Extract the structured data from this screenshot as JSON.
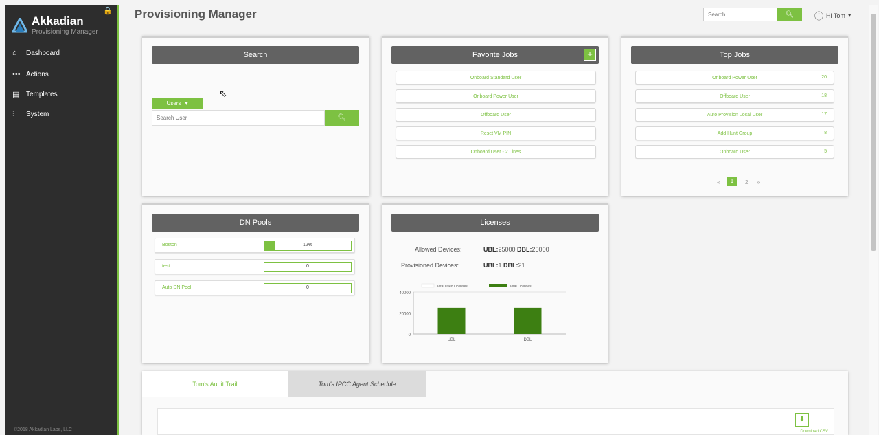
{
  "sidebar": {
    "brand_name": "Akkadian",
    "brand_sub": "Provisioning Manager",
    "items": [
      {
        "label": "Dashboard",
        "icon": "home-icon"
      },
      {
        "label": "Actions",
        "icon": "dots-icon"
      },
      {
        "label": "Templates",
        "icon": "template-icon"
      },
      {
        "label": "System",
        "icon": "sliders-icon"
      }
    ],
    "copyright": "©2018 Akkadian Labs, LLC"
  },
  "header": {
    "title": "Provisioning Manager",
    "search_placeholder": "Search...",
    "user_greeting": "Hi Tom"
  },
  "search_panel": {
    "title": "Search",
    "dropdown_label": "Users",
    "input_placeholder": "Search User"
  },
  "favorite_jobs": {
    "title": "Favorite Jobs",
    "items": [
      "Onboard Standard User",
      "Onboard Power User",
      "Offboard User",
      "Reset VM PIN",
      "Onboard User - 2 Lines"
    ]
  },
  "top_jobs": {
    "title": "Top Jobs",
    "items": [
      {
        "label": "Onboard Power User",
        "count": "20"
      },
      {
        "label": "Offboard User",
        "count": "18"
      },
      {
        "label": "Auto Provision Local User",
        "count": "17"
      },
      {
        "label": "Add Hunt Group",
        "count": "8"
      },
      {
        "label": "Onboard User",
        "count": "5"
      }
    ],
    "pages": [
      "«",
      "1",
      "2",
      "»"
    ]
  },
  "dn_pools": {
    "title": "DN Pools",
    "rows": [
      {
        "name": "Boston",
        "percent_label": "12%",
        "percent": 0.12
      },
      {
        "name": "test",
        "percent_label": "0",
        "percent": 0
      },
      {
        "name": "Auto DN Pool",
        "percent_label": "0",
        "percent": 0
      }
    ]
  },
  "licenses": {
    "title": "Licenses",
    "allowed_label": "Allowed Devices:",
    "allowed_ubl_key": "UBL:",
    "allowed_ubl_val": "25000",
    "allowed_dbl_key": "DBL:",
    "allowed_dbl_val": "25000",
    "provisioned_label": "Provisioned Devices:",
    "prov_ubl_key": "UBL:",
    "prov_ubl_val": "1",
    "prov_dbl_key": "DBL:",
    "prov_dbl_val": "21"
  },
  "chart_data": {
    "type": "bar",
    "categories": [
      "UBL",
      "DBL"
    ],
    "series": [
      {
        "name": "Total Used Licenses",
        "values": [
          1,
          21
        ],
        "color": "#ffffff"
      },
      {
        "name": "Total Licenses",
        "values": [
          25000,
          25000
        ],
        "color": "#3d7f12"
      }
    ],
    "ylim": [
      0,
      40000
    ],
    "yticks": [
      "40000",
      "20000",
      "0"
    ],
    "legend": "top"
  },
  "tabs": {
    "audit": "Tom's Audit Trail",
    "ipcc": "Tom's IPCC Agent Schedule",
    "download_label": "Download CSV"
  },
  "colors": {
    "accent": "#7dc142",
    "sidebar": "#2d2d2d",
    "panel_header": "#626262"
  }
}
